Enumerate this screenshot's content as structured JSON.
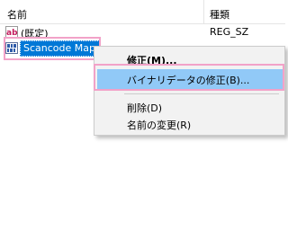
{
  "columns": {
    "name": "名前",
    "type": "種類"
  },
  "rows": [
    {
      "name": "(既定)",
      "type": "REG_SZ",
      "icon": "string-value-icon"
    },
    {
      "name": "Scancode Map",
      "type": "",
      "icon": "binary-value-icon"
    }
  ],
  "context_menu": {
    "items": [
      {
        "label": "修正(M)..."
      },
      {
        "label": "バイナリデータの修正(B)..."
      },
      {
        "label": "削除(D)"
      },
      {
        "label": "名前の変更(R)"
      }
    ]
  },
  "colors": {
    "selection": "#0078d7",
    "highlight": "#91c9f7",
    "annotation": "#f2a2c8",
    "menu_background": "#f2f2f2"
  }
}
